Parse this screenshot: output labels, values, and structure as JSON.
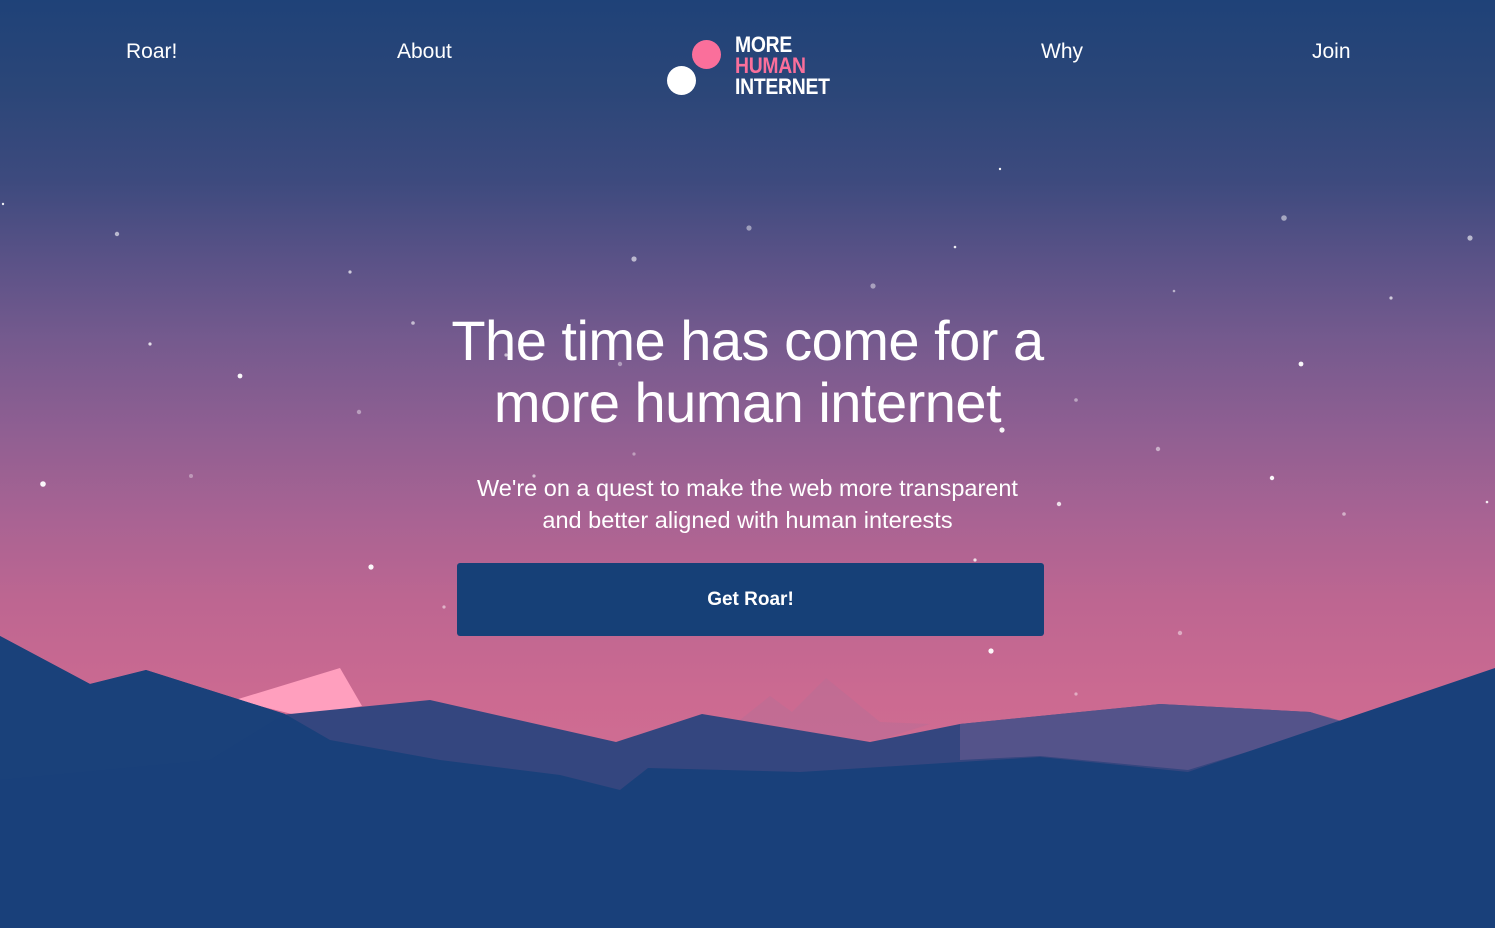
{
  "nav": {
    "left_items": [
      "Roar!",
      "About"
    ],
    "right_items": [
      "Why",
      "Join"
    ]
  },
  "logo": {
    "line1": "MORE",
    "line2": "HUMAN",
    "line3": "INTERNET",
    "accent_color": "#fa6f9b"
  },
  "hero": {
    "headline_line1": "The time has come for a",
    "headline_line2": "more human internet",
    "subtext_line1": "We're on a quest to make the web more transparent",
    "subtext_line2": "and better aligned with human interests",
    "cta_label": "Get Roar!"
  },
  "colors": {
    "navy": "#164077",
    "pink": "#fa6f9b",
    "sky_top": "#1f4278",
    "sky_bottom": "#d06d92"
  }
}
